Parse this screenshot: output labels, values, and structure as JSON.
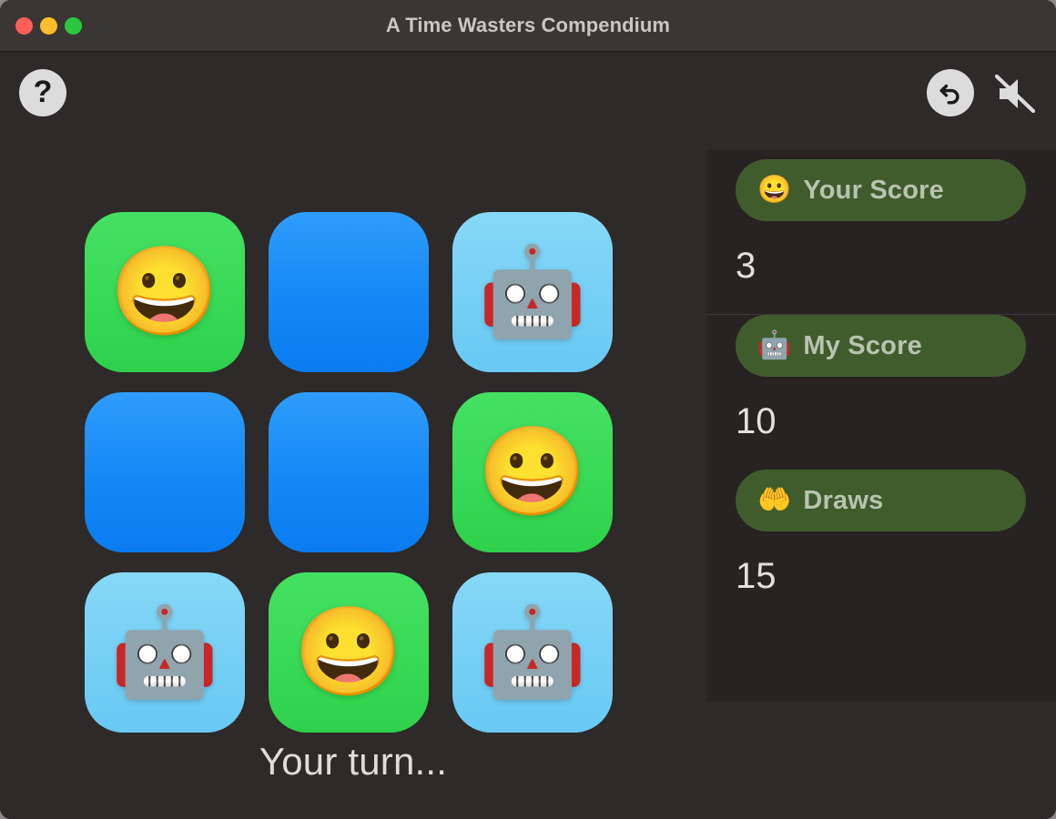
{
  "window": {
    "title": "A Time Wasters Compendium",
    "traffic_lights": [
      {
        "name": "close-button",
        "color": "#ff5f57"
      },
      {
        "name": "minimize-button",
        "color": "#febc2e"
      },
      {
        "name": "maximize-button",
        "color": "#28c840"
      }
    ]
  },
  "toolbar": {
    "help": {
      "icon": "question-mark-icon",
      "glyph": "?"
    },
    "undo": {
      "icon": "undo-arrow-icon"
    },
    "mute": {
      "icon": "speaker-muted-icon"
    }
  },
  "board": {
    "cells": [
      {
        "state": "player",
        "mark": "😀"
      },
      {
        "state": "empty",
        "mark": ""
      },
      {
        "state": "computer",
        "mark": "🤖"
      },
      {
        "state": "empty",
        "mark": ""
      },
      {
        "state": "empty",
        "mark": ""
      },
      {
        "state": "player",
        "mark": "😀"
      },
      {
        "state": "computer",
        "mark": "🤖"
      },
      {
        "state": "player",
        "mark": "😀"
      },
      {
        "state": "computer",
        "mark": "🤖"
      }
    ],
    "colors": {
      "empty": "#1488f6",
      "player": "#37d954",
      "computer": "#74cff5"
    }
  },
  "status": {
    "text": "Your turn..."
  },
  "scores": {
    "pill_color": "#405c2c",
    "rows": [
      {
        "icon": "😀",
        "icon_name": "grinning-face-icon",
        "label": "Your Score",
        "value": "3"
      },
      {
        "icon": "🤖",
        "icon_name": "robot-face-icon",
        "label": "My Score",
        "value": "10"
      },
      {
        "icon": "🤲",
        "icon_name": "palms-up-icon",
        "label": "Draws",
        "value": "15"
      }
    ]
  }
}
